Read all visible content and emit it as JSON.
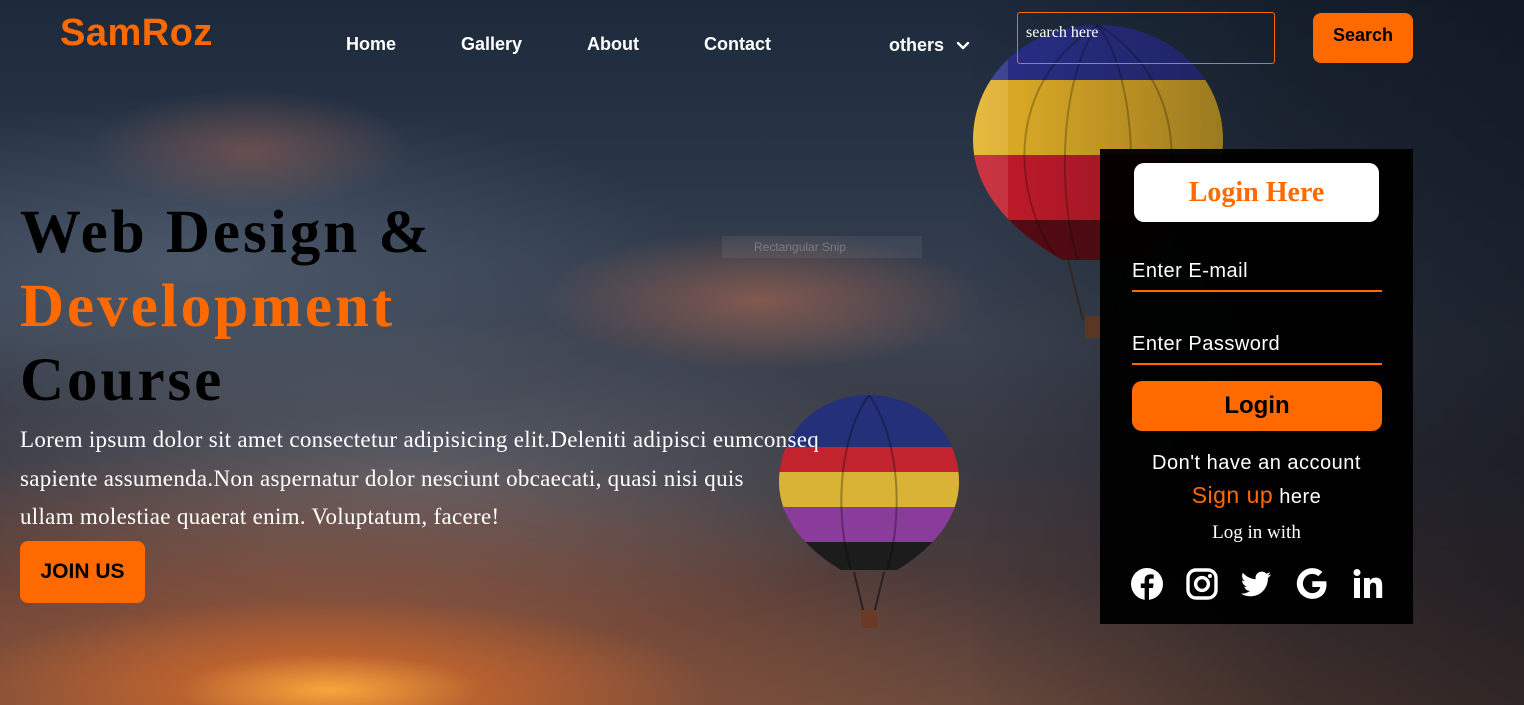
{
  "brand": {
    "name": "SamRoz",
    "color": "#ff6a00"
  },
  "nav": {
    "items": [
      {
        "label": "Home"
      },
      {
        "label": "Gallery"
      },
      {
        "label": "About"
      },
      {
        "label": "Contact"
      }
    ],
    "dropdown_label": "others"
  },
  "search": {
    "placeholder": "search here",
    "value": "",
    "button_label": "Search"
  },
  "hero": {
    "title_line1": "Web Design &",
    "title_line2": "Development",
    "title_line3": "Course",
    "body_line1": "Lorem ipsum dolor sit amet consectetur adipisicing elit.Deleniti adipisci eumconseq",
    "body_line2": "sapiente assumenda.Non aspernatur dolor nesciunt obcaecati, quasi nisi quis",
    "body_line3": "ullam molestiae quaerat enim. Voluptatum, facere!",
    "join_label": "JOIN US"
  },
  "login": {
    "heading": "Login Here",
    "email_placeholder": "Enter E-mail",
    "password_placeholder": "Enter Password",
    "button_label": "Login",
    "no_account_text": "Don't have an account",
    "signup_link": "Sign up",
    "signup_suffix": " here",
    "login_with": "Log in with",
    "social": [
      "facebook-icon",
      "instagram-icon",
      "twitter-icon",
      "google-icon",
      "linkedin-icon"
    ]
  },
  "background_snip_text": "Rectangular Snip"
}
